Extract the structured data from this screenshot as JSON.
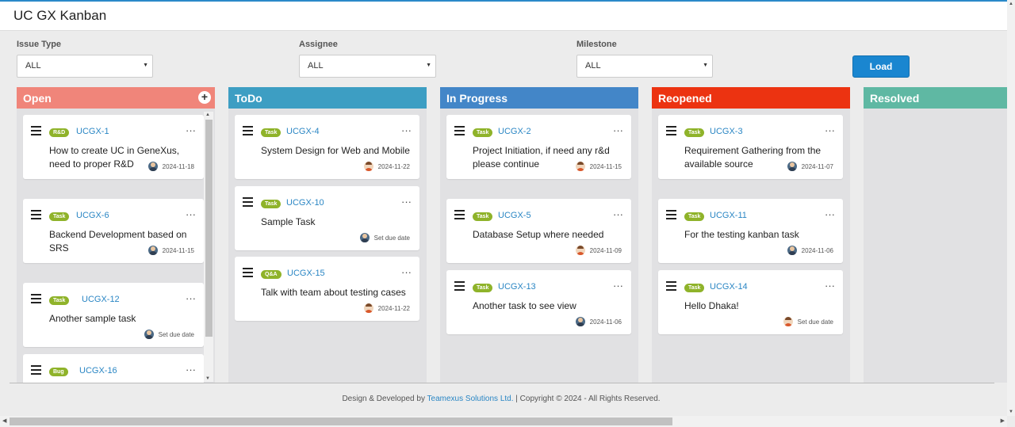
{
  "app": {
    "title": "UC GX Kanban"
  },
  "filters": {
    "issue_type": {
      "label": "Issue Type",
      "value": "ALL"
    },
    "assignee": {
      "label": "Assignee",
      "value": "ALL"
    },
    "milestone": {
      "label": "Milestone",
      "value": "ALL"
    },
    "load_label": "Load"
  },
  "columns": {
    "open": {
      "title": "Open",
      "color": "#f0857a",
      "add": "+",
      "cards": [
        {
          "badge": "R&D",
          "key": "UCGX-1",
          "title": "How to create UC in GeneXus, need to proper R&D",
          "due": "2024-11-18"
        },
        {
          "badge": "Task",
          "key": "UCGX-6",
          "title": "Backend Development based on SRS",
          "due": "2024-11-15"
        },
        {
          "badge": "Task",
          "key": "UCGX-12",
          "title": "Another sample task",
          "due": "Set due date"
        },
        {
          "badge": "Bug",
          "key": "UCGX-16",
          "title": "",
          "due": ""
        }
      ]
    },
    "todo": {
      "title": "ToDo",
      "color": "#3d9ec3",
      "cards": [
        {
          "badge": "Task",
          "key": "UCGX-4",
          "title": "System Design for Web and Mobile",
          "due": "2024-11-22"
        },
        {
          "badge": "Task",
          "key": "UCGX-10",
          "title": "Sample Task",
          "due": "Set due date"
        },
        {
          "badge": "Q&A",
          "key": "UCGX-15",
          "title": "Talk with team about testing cases",
          "due": "2024-11-22"
        }
      ]
    },
    "inprogress": {
      "title": "In Progress",
      "color": "#4386c8",
      "cards": [
        {
          "badge": "Task",
          "key": "UCGX-2",
          "title": "Project Initiation, if need any r&d please continue",
          "due": "2024-11-15"
        },
        {
          "badge": "Task",
          "key": "UCGX-5",
          "title": "Database Setup where needed",
          "due": "2024-11-09"
        },
        {
          "badge": "Task",
          "key": "UCGX-13",
          "title": "Another task to see view",
          "due": "2024-11-06"
        }
      ]
    },
    "reopened": {
      "title": "Reopened",
      "color": "#ec3311",
      "cards": [
        {
          "badge": "Task",
          "key": "UCGX-3",
          "title": "Requirement Gathering from the available source",
          "due": "2024-11-07"
        },
        {
          "badge": "Task",
          "key": "UCGX-11",
          "title": "For the testing kanban task",
          "due": "2024-11-06"
        },
        {
          "badge": "Task",
          "key": "UCGX-14",
          "title": "Hello Dhaka!",
          "due": "Set due date"
        }
      ]
    },
    "resolved": {
      "title": "Resolved",
      "color": "#5fb8a3",
      "cards": []
    }
  },
  "footer": {
    "prefix": "Design & Developed by ",
    "company": "Teamexus Solutions Ltd.",
    "suffix": " | Copyright © 2024 - All Rights Reserved."
  },
  "colors": {
    "accent": "#1a86d0",
    "badge": "#8fb32a",
    "link": "#2a86c4"
  }
}
